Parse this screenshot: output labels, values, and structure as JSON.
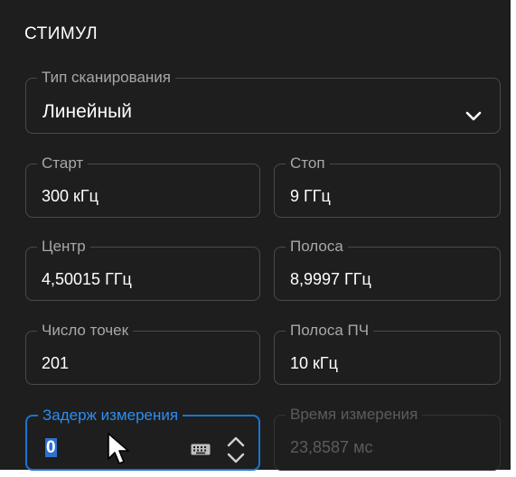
{
  "panel": {
    "title": "СТИМУЛ"
  },
  "sweep_type": {
    "label": "Тип сканирования",
    "value": "Линейный"
  },
  "fields": {
    "start": {
      "label": "Старт",
      "value": "300 кГц"
    },
    "stop": {
      "label": "Стоп",
      "value": "9 ГГц"
    },
    "center": {
      "label": "Центр",
      "value": "4,50015 ГГц"
    },
    "span": {
      "label": "Полоса",
      "value": "8,9997 ГГц"
    },
    "points": {
      "label": "Число точек",
      "value": "201"
    },
    "ifbw": {
      "label": "Полоса ПЧ",
      "value": "10 кГц"
    },
    "delay": {
      "label": "Задерж измерения",
      "value": "0"
    },
    "sweep_time": {
      "label": "Время измерения",
      "value": "23,8587 мс"
    }
  },
  "colors": {
    "background": "#1e1e1e",
    "border": "#4a4a4a",
    "accent": "#1976d2",
    "label": "#a8a8a8",
    "disabled": "#5c5c5c"
  },
  "icons": {
    "dropdown": "chevron-down-icon",
    "keyboard": "keyboard-icon",
    "spinner": "up-down-arrows-icon",
    "pointer": "mouse-cursor-icon"
  }
}
